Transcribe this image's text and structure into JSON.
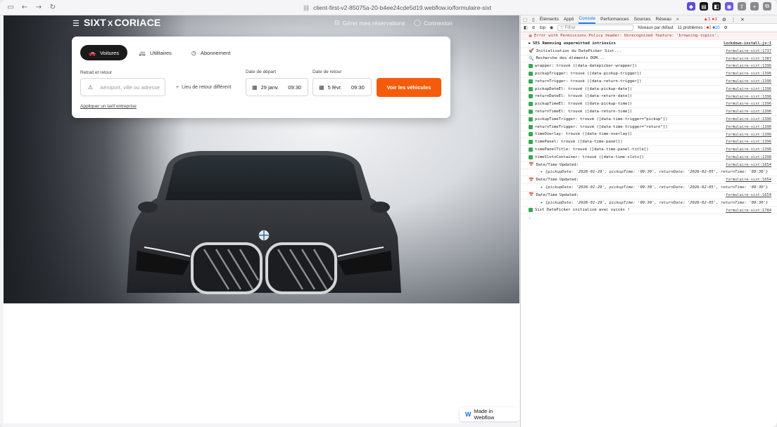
{
  "browser": {
    "url": "client-first-v2-85075a-20-b4ee24cde5d19.webflow.io/formulaire-sixt"
  },
  "site": {
    "logo_sixt": "SIXT",
    "logo_x": "X",
    "logo_partner": "CORIACE",
    "nav_reservations": "Gérer mes réservations",
    "nav_login": "Connexion"
  },
  "booking": {
    "tabs": [
      {
        "label": "Voitures",
        "icon": "car-icon",
        "active": true
      },
      {
        "label": "Utilitaires",
        "icon": "van-icon",
        "active": false
      },
      {
        "label": "Abonnement",
        "icon": "clock-icon",
        "active": false
      }
    ],
    "pickup_label": "Retrait et retour",
    "pickup_placeholder": "Aéroport, ville ou adresse",
    "dropoff_label": "Lieu de retour différent",
    "departure_label": "Date de départ",
    "departure_date": "29 janv.",
    "departure_time": "09:30",
    "return_label": "Date de retour",
    "return_date": "5 févr.",
    "return_time": "09:30",
    "cta": "Voir les véhicules",
    "corporate_link": "Appliquer un tarif entreprise"
  },
  "badge": {
    "label": "Made in Webflow"
  },
  "devtools": {
    "tabs": [
      "Éléments",
      "Appli",
      "Console",
      "Performances",
      "Sources",
      "Réseau"
    ],
    "active_tab": "Console",
    "context": "top",
    "filter_placeholder": "Filtrer",
    "levels": "Niveaux par défaut",
    "issues": "11 problèmes :",
    "issues_errors": "1",
    "issues_info": "10",
    "warn_count": "1",
    "err_count": "1",
    "messages": [
      {
        "kind": "error",
        "text": "Error with Permissions-Policy header: Unrecognized feature: 'browsing-topics'.",
        "src": ""
      },
      {
        "kind": "bold",
        "text": "SES Removing unpermitted intrinsics",
        "src": "lockdown-install.js:1"
      },
      {
        "kind": "icon",
        "icon": "🚀",
        "text": "Initialisation du DatePicker Sixt...",
        "src": "formulaire-sixt:1737"
      },
      {
        "kind": "icon",
        "icon": "🔍",
        "text": "Recherche des éléments DOM...",
        "src": "formulaire-sixt:1387"
      },
      {
        "kind": "check",
        "text": "wrapper: trouvé ([data-datepicker-wrapper])",
        "src": "formulaire-sixt:1396"
      },
      {
        "kind": "check",
        "text": "pickupTrigger: trouvé ([data-pickup-trigger])",
        "src": "formulaire-sixt:1396"
      },
      {
        "kind": "check",
        "text": "returnTrigger: trouvé ([data-return-trigger])",
        "src": "formulaire-sixt:1396"
      },
      {
        "kind": "check",
        "text": "pickupDateEl: trouvé ([data-pickup-date])",
        "src": "formulaire-sixt:1396"
      },
      {
        "kind": "check",
        "text": "returnDateEl: trouvé ([data-return-date])",
        "src": "formulaire-sixt:1396"
      },
      {
        "kind": "check",
        "text": "pickupTimeEl: trouvé ([data-pickup-time])",
        "src": "formulaire-sixt:1396"
      },
      {
        "kind": "check",
        "text": "returnTimeEl: trouvé ([data-return-time])",
        "src": "formulaire-sixt:1396"
      },
      {
        "kind": "check",
        "text": "pickupTimeTrigger: trouvé ([data-time-trigger=\"pickup\"])",
        "src": "formulaire-sixt:1396"
      },
      {
        "kind": "check",
        "text": "returnTimeTrigger: trouvé ([data-time-trigger=\"return\"])",
        "src": "formulaire-sixt:1396"
      },
      {
        "kind": "check",
        "text": "timeOverlay: trouvé ([data-time-overlay])",
        "src": "formulaire-sixt:1396"
      },
      {
        "kind": "check",
        "text": "timePanel: trouvé ([data-time-panel])",
        "src": "formulaire-sixt:1396"
      },
      {
        "kind": "check",
        "text": "timePanelTitle: trouvé ([data-time-panel-title])",
        "src": "formulaire-sixt:1396"
      },
      {
        "kind": "check",
        "text": "timeSlotsContainer: trouvé ([data-time-slots])",
        "src": "formulaire-sixt:1398"
      },
      {
        "kind": "icon",
        "icon": "📅",
        "text": "Date/Time Updated:",
        "src": "formulaire-sixt:1654"
      },
      {
        "kind": "obj",
        "text": "▸ {pickupDate: '2026-01-29', pickupTime: '09:30', returnDate: '2026-02-05', returnTime: '09:30'}",
        "src": ""
      },
      {
        "kind": "icon",
        "icon": "📅",
        "text": "Date/Time Updated:",
        "src": "formulaire-sixt:1654"
      },
      {
        "kind": "obj",
        "text": "▸ {pickupDate: '2026-01-29', pickupTime: '09:30', returnDate: '2026-02-05', returnTime: '09:30'}",
        "src": ""
      },
      {
        "kind": "icon",
        "icon": "📅",
        "text": "Date/Time Updated:",
        "src": "formulaire-sixt:1654"
      },
      {
        "kind": "obj",
        "text": "▸ {pickupDate: '2026-01-29', pickupTime: '09:30', returnDate: '2026-02-05', returnTime: '09:30'}",
        "src": ""
      },
      {
        "kind": "check",
        "text": "Sixt DatePicker initialisé avec succès !",
        "src": "formulaire-sixt:1784"
      }
    ],
    "prompt": "›"
  }
}
